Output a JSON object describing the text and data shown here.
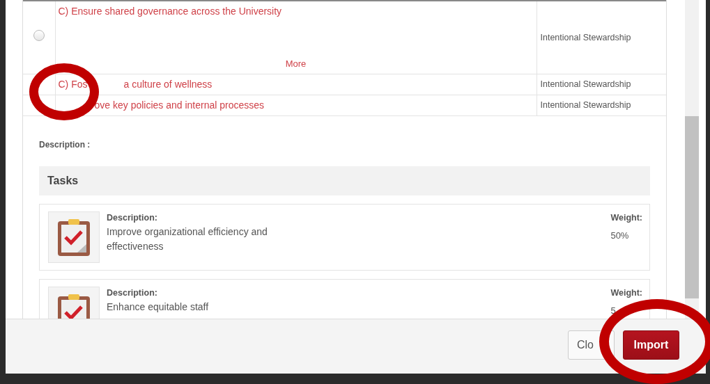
{
  "goals": [
    {
      "text_parts": [
        "C) Ensure shared governance across the University"
      ],
      "more": "More",
      "category": "Intentional Stewardship",
      "selected": false
    },
    {
      "text_parts": [
        "C) Fos",
        "a culture of wellness"
      ],
      "category": "Intentional Stewardship"
    },
    {
      "text_parts": [
        "ove key policies and internal processes"
      ],
      "category": "Intentional Stewardship"
    }
  ],
  "description_label": "Description :",
  "tasks_title": "Tasks",
  "tasks": [
    {
      "description_label": "Description:",
      "description": "Improve organizational efficiency and effectiveness",
      "weight_label": "Weight:",
      "weight": "50%"
    },
    {
      "description_label": "Description:",
      "description": "Enhance equitable staff",
      "weight_label": "Weight:",
      "weight": "5"
    }
  ],
  "buttons": [
    {
      "label": "Clo",
      "kind": "secondary"
    },
    {
      "label": "Import",
      "kind": "primary"
    }
  ],
  "annotations": [
    {
      "kind": "ring"
    },
    {
      "kind": "ring"
    }
  ]
}
